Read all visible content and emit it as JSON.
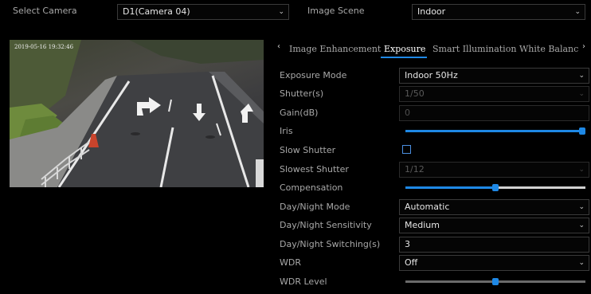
{
  "top": {
    "camera_label": "Select Camera",
    "camera_value": "D1(Camera 04)",
    "scene_label": "Image Scene",
    "scene_value": "Indoor"
  },
  "preview": {
    "timestamp": "2019-05-16 19:32:46"
  },
  "tabs": [
    {
      "label": "Image Enhancement",
      "active": false
    },
    {
      "label": "Exposure",
      "active": true
    },
    {
      "label": "Smart Illumination",
      "active": false
    },
    {
      "label": "White Balanc",
      "active": false
    }
  ],
  "settings": {
    "exposure_mode": {
      "label": "Exposure Mode",
      "value": "Indoor 50Hz"
    },
    "shutter": {
      "label": "Shutter(s)",
      "value": "1/50"
    },
    "gain": {
      "label": "Gain(dB)",
      "value": "0"
    },
    "iris": {
      "label": "Iris",
      "level": 1.0
    },
    "slow_shutter": {
      "label": "Slow Shutter",
      "checked": false
    },
    "slowest_shutter": {
      "label": "Slowest Shutter",
      "value": "1/12"
    },
    "compensation": {
      "label": "Compensation",
      "level": 0.5
    },
    "day_night_mode": {
      "label": "Day/Night Mode",
      "value": "Automatic"
    },
    "day_night_sensitivity": {
      "label": "Day/Night Sensitivity",
      "value": "Medium"
    },
    "day_night_switching": {
      "label": "Day/Night Switching(s)",
      "value": "3"
    },
    "wdr": {
      "label": "WDR",
      "value": "Off"
    },
    "wdr_level": {
      "label": "WDR Level",
      "level": 0.5
    }
  },
  "colors": {
    "accent": "#1e88e5",
    "background": "#000000"
  }
}
